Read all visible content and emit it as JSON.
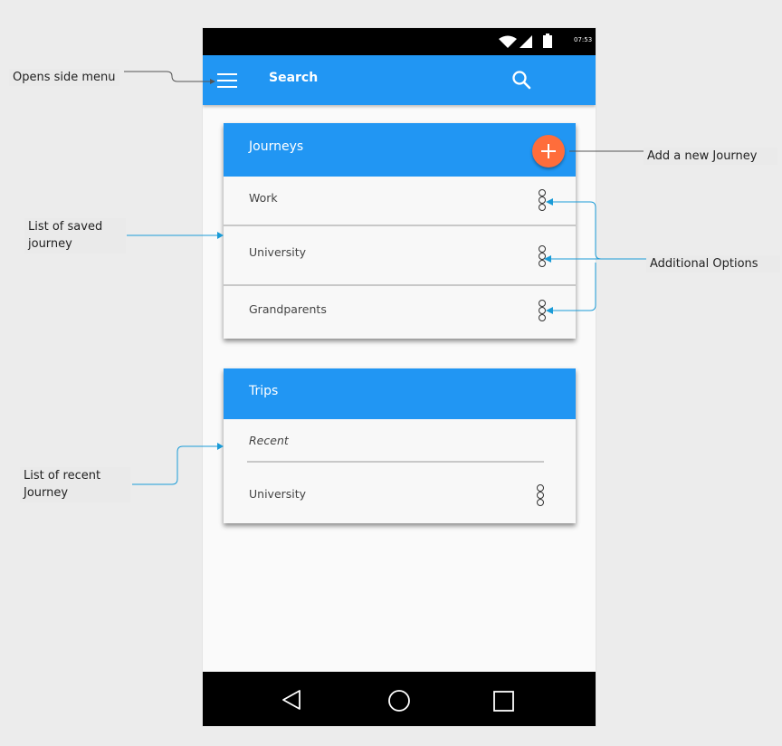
{
  "status_bar": {
    "time": "07:53"
  },
  "app_bar": {
    "title": "Search"
  },
  "journeys_card": {
    "title": "Journeys",
    "items": [
      {
        "label": "Work"
      },
      {
        "label": "University"
      },
      {
        "label": "Grandparents"
      }
    ]
  },
  "trips_card": {
    "title": "Trips",
    "section_label": "Recent",
    "items": [
      {
        "label": "University"
      }
    ]
  },
  "annotations": {
    "side_menu": "Opens side menu",
    "add_journey": "Add a new Journey",
    "saved_journey_line1": "List of saved",
    "saved_journey_line2": "journey",
    "additional_options": "Additional Options",
    "recent_journey_line1": "List of recent",
    "recent_journey_line2": "Journey"
  },
  "colors": {
    "primary": "#2196f3",
    "fab": "#ff6d3b",
    "annotation_line": "#1a9bd7"
  },
  "icons": [
    "menu-icon",
    "search-icon",
    "add-icon",
    "more-options-icon",
    "back-icon",
    "home-icon",
    "recents-icon",
    "wifi-icon",
    "signal-icon",
    "battery-icon"
  ]
}
